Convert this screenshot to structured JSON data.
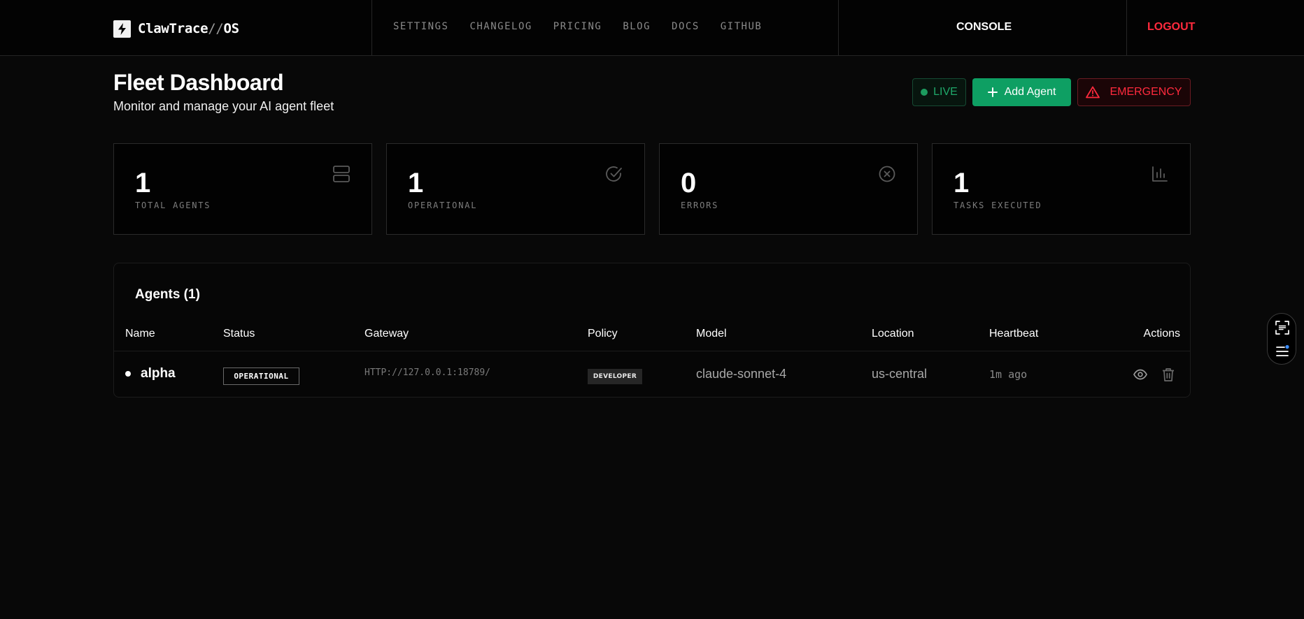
{
  "nav": {
    "brand_main": "ClawTrace",
    "brand_slash": "//",
    "brand_suffix": "OS",
    "links": [
      "SETTINGS",
      "CHANGELOG",
      "PRICING",
      "BLOG",
      "DOCS",
      "GITHUB"
    ],
    "console": "CONSOLE",
    "logout": "LOGOUT"
  },
  "header": {
    "title": "Fleet Dashboard",
    "subtitle": "Monitor and manage your AI agent fleet",
    "live_label": "LIVE",
    "add_agent_label": "Add Agent",
    "emergency_label": "EMERGENCY"
  },
  "stats": [
    {
      "value": "1",
      "label": "TOTAL AGENTS",
      "icon": "server-icon"
    },
    {
      "value": "1",
      "label": "OPERATIONAL",
      "icon": "check-circle-icon"
    },
    {
      "value": "0",
      "label": "ERRORS",
      "icon": "x-circle-icon"
    },
    {
      "value": "1",
      "label": "TASKS EXECUTED",
      "icon": "bar-chart-icon"
    }
  ],
  "agents": {
    "title": "Agents (1)",
    "columns": [
      "Name",
      "Status",
      "Gateway",
      "Policy",
      "Model",
      "Location",
      "Heartbeat",
      "Actions"
    ],
    "rows": [
      {
        "name": "alpha",
        "status": "OPERATIONAL",
        "gateway": "HTTP://127.0.0.1:18789/",
        "policy": "DEVELOPER",
        "model": "claude-sonnet-4",
        "location": "us-central",
        "heartbeat": "1m ago"
      }
    ]
  },
  "colors": {
    "accent_green": "#0e9f63",
    "danger_red": "#ff2a3d",
    "background": "#080808"
  }
}
